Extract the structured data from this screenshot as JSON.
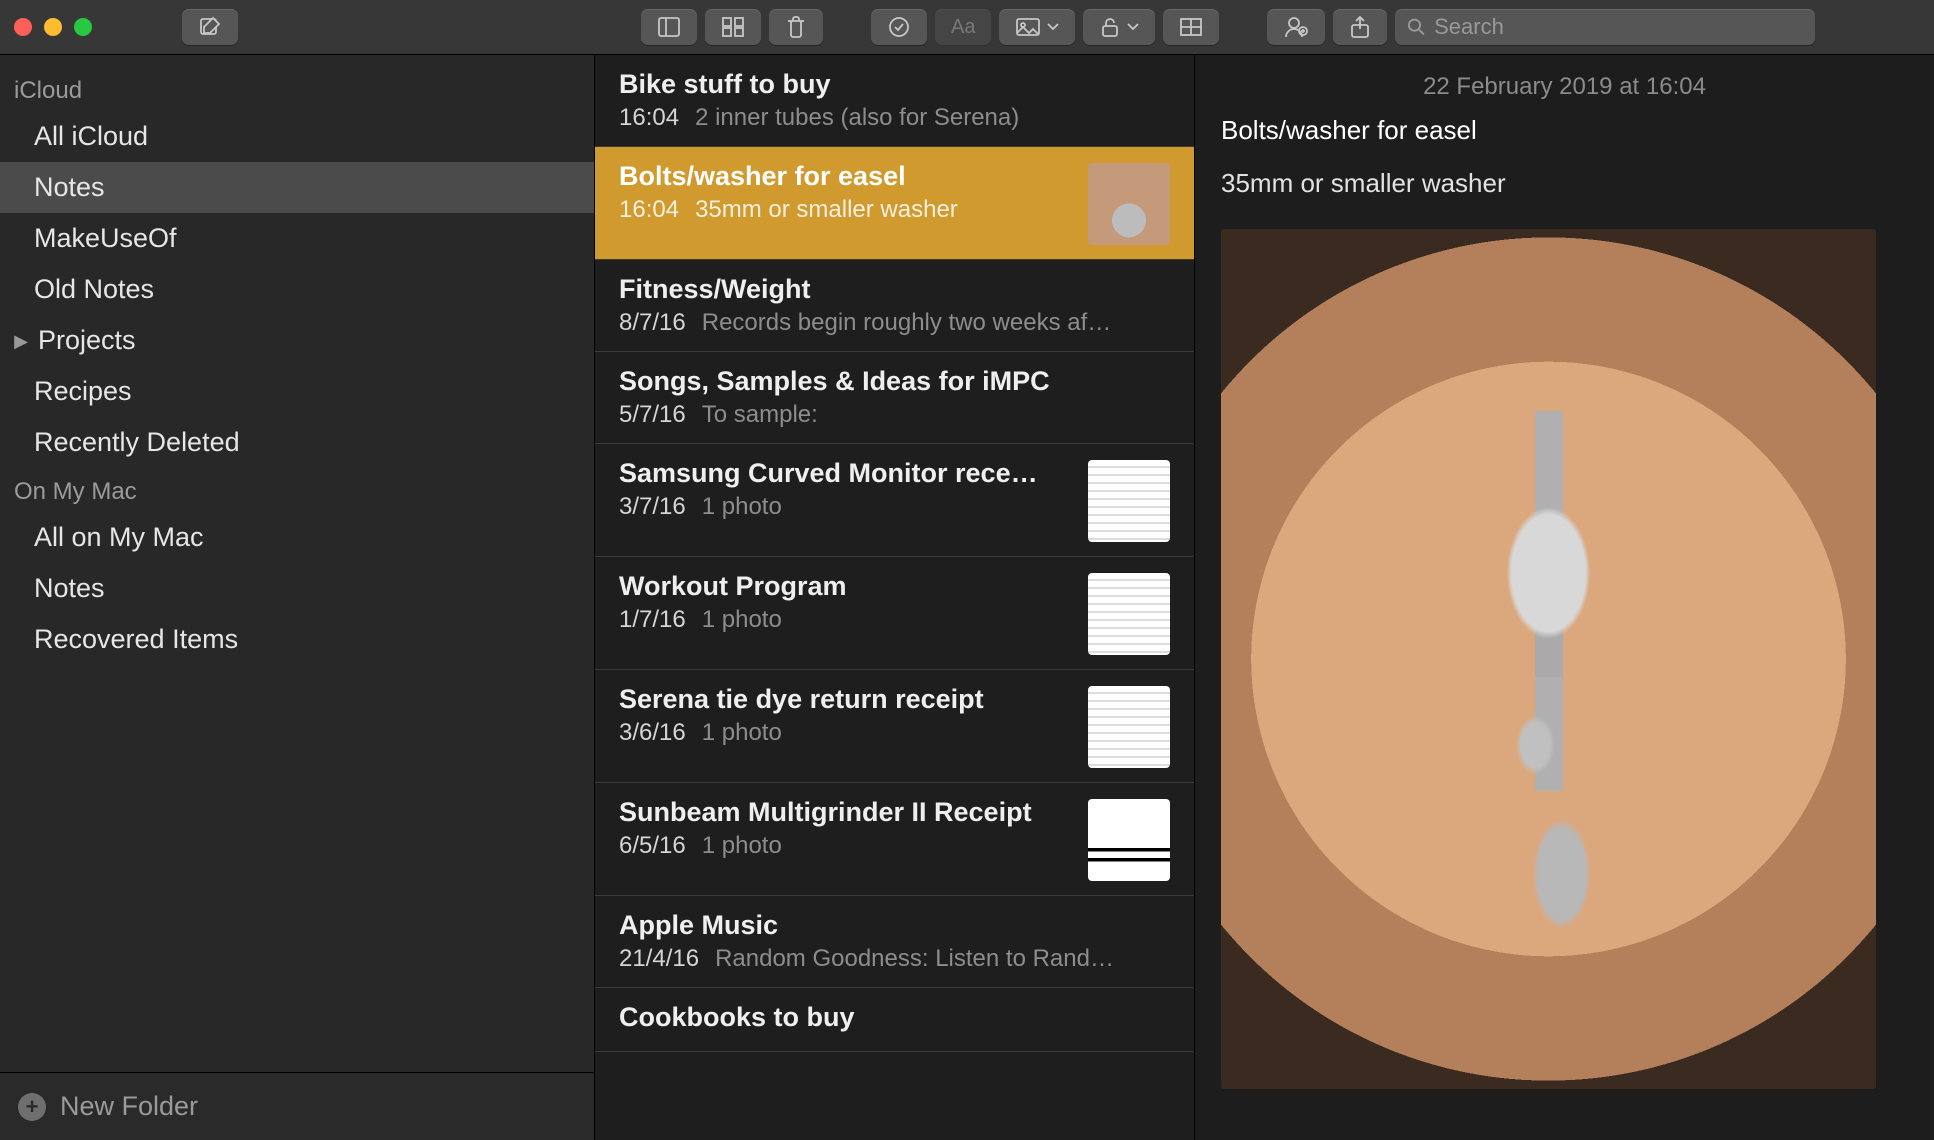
{
  "toolbar": {
    "search_placeholder": "Search"
  },
  "sidebar": {
    "sections": [
      {
        "label": "iCloud",
        "items": [
          {
            "label": "All iCloud"
          },
          {
            "label": "Notes",
            "selected": true
          },
          {
            "label": "MakeUseOf"
          },
          {
            "label": "Old Notes"
          },
          {
            "label": "Projects",
            "disclosure": true
          },
          {
            "label": "Recipes"
          },
          {
            "label": "Recently Deleted"
          }
        ]
      },
      {
        "label": "On My Mac",
        "items": [
          {
            "label": "All on My Mac"
          },
          {
            "label": "Notes"
          },
          {
            "label": "Recovered Items"
          }
        ]
      }
    ],
    "footer_label": "New Folder"
  },
  "notes": [
    {
      "title": "Bike stuff to buy",
      "date": "16:04",
      "snippet": "2 inner tubes (also for Serena)"
    },
    {
      "title": "Bolts/washer for easel",
      "date": "16:04",
      "snippet": "35mm or smaller washer",
      "selected": true,
      "thumb": "hand"
    },
    {
      "title": "Fitness/Weight",
      "date": "8/7/16",
      "snippet": "Records begin roughly two weeks af…"
    },
    {
      "title": "Songs, Samples & Ideas for iMPC",
      "date": "5/7/16",
      "snippet": "To sample:"
    },
    {
      "title": "Samsung Curved Monitor rece…",
      "date": "3/7/16",
      "snippet": "1 photo",
      "thumb": "receipt"
    },
    {
      "title": "Workout Program",
      "date": "1/7/16",
      "snippet": "1 photo",
      "thumb": "receipt"
    },
    {
      "title": "Serena tie dye return receipt",
      "date": "3/6/16",
      "snippet": "1 photo",
      "thumb": "receipt"
    },
    {
      "title": "Sunbeam Multigrinder II Receipt",
      "date": "6/5/16",
      "snippet": "1 photo",
      "thumb": "barcode"
    },
    {
      "title": "Apple Music",
      "date": "21/4/16",
      "snippet": "Random Goodness: Listen to Rand…"
    },
    {
      "title": "Cookbooks to buy",
      "date": "",
      "snippet": ""
    }
  ],
  "editor": {
    "date": "22 February 2019 at 16:04",
    "title": "Bolts/washer for easel",
    "body": "35mm or smaller washer"
  }
}
